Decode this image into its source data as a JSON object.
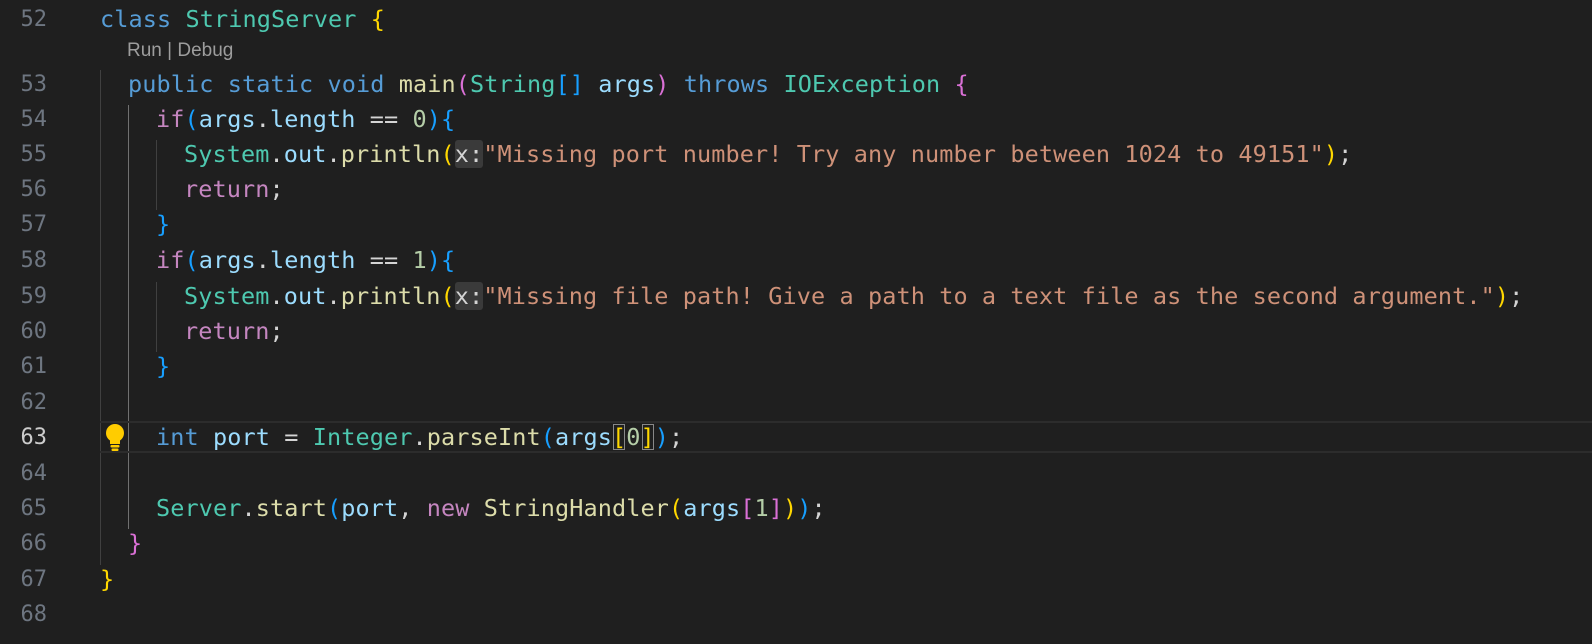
{
  "editor": {
    "codelens": {
      "run": "Run",
      "sep": " | ",
      "debug": "Debug"
    },
    "line_numbers": [
      "52",
      "53",
      "54",
      "55",
      "56",
      "57",
      "58",
      "59",
      "60",
      "61",
      "62",
      "63",
      "64",
      "65",
      "66",
      "67",
      "68"
    ],
    "active_line": "63",
    "code": {
      "l52": {
        "kw_class": "class",
        "class_name": "StringServer",
        "brace": "{"
      },
      "l53": {
        "public": "public",
        "static": "static",
        "void": "void",
        "main": "main",
        "paren_open": "(",
        "string_type": "String",
        "array": "[]",
        "args": "args",
        "paren_close": ")",
        "throws": "throws",
        "exception": "IOException",
        "brace": "{"
      },
      "l54": {
        "if": "if",
        "paren_open": "(",
        "args": "args",
        "dot": ".",
        "length": "length",
        "op": " == ",
        "num": "0",
        "paren_close": ")",
        "brace": "{"
      },
      "l55": {
        "system": "System",
        "dot1": ".",
        "out": "out",
        "dot2": ".",
        "println": "println",
        "paren_open": "(",
        "hint": "x:",
        "string": "\"Missing port number! Try any number between 1024 to 49151\"",
        "paren_close": ")",
        "semi": ";"
      },
      "l56": {
        "return": "return",
        "semi": ";"
      },
      "l57": {
        "brace": "}"
      },
      "l58": {
        "if": "if",
        "paren_open": "(",
        "args": "args",
        "dot": ".",
        "length": "length",
        "op": " == ",
        "num": "1",
        "paren_close": ")",
        "brace": "{"
      },
      "l59": {
        "system": "System",
        "dot1": ".",
        "out": "out",
        "dot2": ".",
        "println": "println",
        "paren_open": "(",
        "hint": "x:",
        "string": "\"Missing file path! Give a path to a text file as the second argument.\"",
        "paren_close": ")",
        "semi": ";"
      },
      "l60": {
        "return": "return",
        "semi": ";"
      },
      "l61": {
        "brace": "}"
      },
      "l63": {
        "int": "int",
        "port": "port",
        "eq": " = ",
        "integer": "Integer",
        "dot": ".",
        "parse": "parseInt",
        "paren_open": "(",
        "args": "args",
        "bracket_open": "[",
        "num": "0",
        "bracket_close": "]",
        "paren_close": ")",
        "semi": ";"
      },
      "l65": {
        "server": "Server",
        "dot": ".",
        "start": "start",
        "paren_open": "(",
        "port": "port",
        "comma": ", ",
        "new": "new",
        "handler": "StringHandler",
        "paren2_open": "(",
        "args": "args",
        "bracket_open": "[",
        "num": "1",
        "bracket_close": "]",
        "paren2_close": ")",
        "paren_close": ")",
        "semi": ";"
      },
      "l66": {
        "brace": "}"
      },
      "l67": {
        "brace": "}"
      }
    },
    "lightbulb_icon": "lightbulb-icon"
  }
}
